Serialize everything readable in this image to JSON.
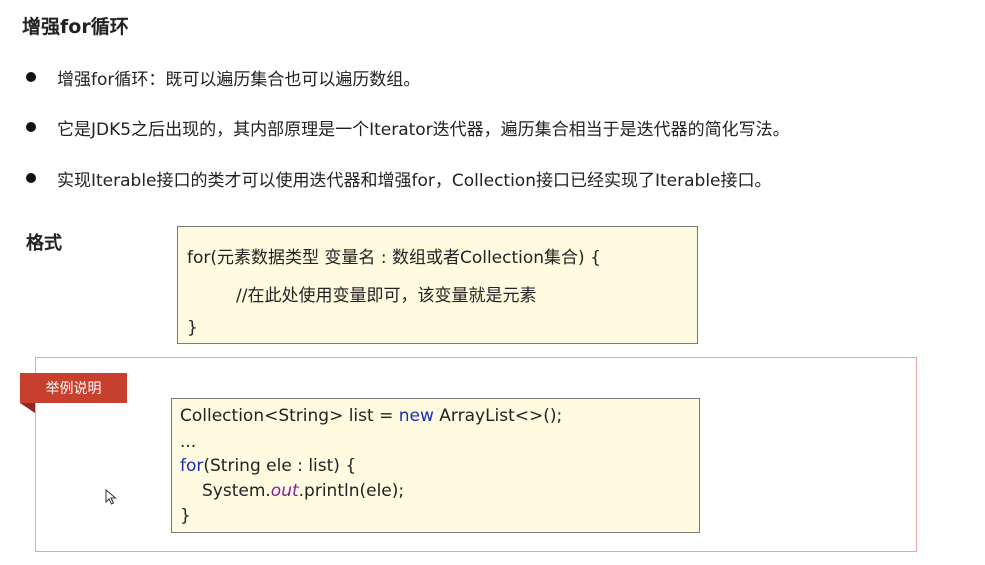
{
  "title": "增强for循环",
  "bullets": [
    "增强for循环：既可以遍历集合也可以遍历数组。",
    "它是JDK5之后出现的，其内部原理是一个Iterator迭代器，遍历集合相当于是迭代器的简化写法。",
    "实现Iterable接口的类才可以使用迭代器和增强for，Collection接口已经实现了Iterable接口。"
  ],
  "format": {
    "label": "格式",
    "lines": [
      "for(元素数据类型 变量名 : 数组或者Collection集合) {",
      "//在此处使用变量即可，该变量就是元素",
      "}"
    ]
  },
  "example": {
    "tag": "举例说明",
    "code": {
      "line1_before": "Collection<String> list = ",
      "line1_keyword": "new",
      "line1_after": " ArrayList<>();",
      "line2": "...",
      "line3_keyword": "for",
      "line3_after": "(String ele : list) {",
      "line4_before": "System.",
      "line4_field": "out",
      "line4_after": ".println(ele);",
      "line5": "}"
    }
  },
  "colors": {
    "keyword": "#1a2db8",
    "field": "#8b1a9e",
    "tag_background": "#c7402d",
    "code_background": "#fffbe0"
  },
  "icons": [
    "bullet-dot-icon",
    "mouse-cursor-icon"
  ]
}
